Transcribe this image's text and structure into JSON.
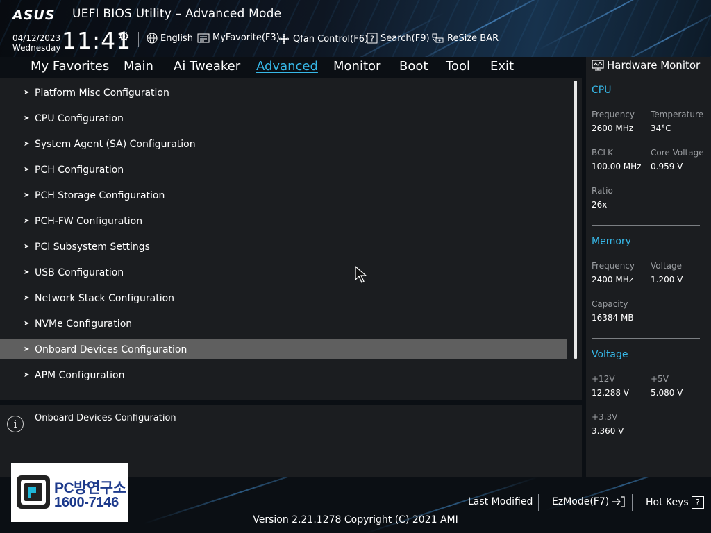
{
  "header": {
    "brand": "ASUS",
    "title": "UEFI BIOS Utility – Advanced Mode",
    "date": "04/12/2023",
    "weekday": "Wednesday",
    "time": "11:41",
    "settings_icon": "gear-icon",
    "toolbar": [
      {
        "label": "English",
        "icon": "globe-icon"
      },
      {
        "label": "MyFavorite(F3)",
        "icon": "favorite-icon"
      },
      {
        "label": "Qfan Control(F6)",
        "icon": "fan-icon"
      },
      {
        "label": "Search(F9)",
        "icon": "search-help-icon"
      },
      {
        "label": "ReSize BAR",
        "icon": "resize-bar-icon"
      }
    ]
  },
  "menu": {
    "items": [
      "My Favorites",
      "Main",
      "Ai Tweaker",
      "Advanced",
      "Monitor",
      "Boot",
      "Tool",
      "Exit"
    ],
    "active": "Advanced"
  },
  "advanced": {
    "items": [
      "Platform Misc Configuration",
      "CPU Configuration",
      "System Agent (SA) Configuration",
      "PCH Configuration",
      "PCH Storage Configuration",
      "PCH-FW Configuration",
      "PCI Subsystem Settings",
      "USB Configuration",
      "Network Stack Configuration",
      "NVMe Configuration",
      "Onboard Devices Configuration",
      "APM Configuration"
    ],
    "selected": "Onboard Devices Configuration"
  },
  "info": {
    "text": "Onboard Devices Configuration"
  },
  "hardware_monitor": {
    "title": "Hardware Monitor",
    "cpu": {
      "heading": "CPU",
      "frequency_label": "Frequency",
      "frequency": "2600 MHz",
      "temperature_label": "Temperature",
      "temperature": "34°C",
      "bclk_label": "BCLK",
      "bclk": "100.00 MHz",
      "core_voltage_label": "Core Voltage",
      "core_voltage": "0.959 V",
      "ratio_label": "Ratio",
      "ratio": "26x"
    },
    "memory": {
      "heading": "Memory",
      "frequency_label": "Frequency",
      "frequency": "2400 MHz",
      "voltage_label": "Voltage",
      "voltage": "1.200 V",
      "capacity_label": "Capacity",
      "capacity": "16384 MB"
    },
    "voltage": {
      "heading": "Voltage",
      "v12_label": "+12V",
      "v12": "12.288 V",
      "v5_label": "+5V",
      "v5": "5.080 V",
      "v33_label": "+3.3V",
      "v33": "3.360 V"
    }
  },
  "footer": {
    "last_modified": "Last Modified",
    "ezmode": "EzMode(F7)",
    "hot_keys": "Hot Keys",
    "hot_keys_icon": "?",
    "version": "Version 2.21.1278 Copyright (C) 2021 AMI"
  },
  "watermark": {
    "line1": "PC방연구소",
    "line2": "1600-7146"
  },
  "colors": {
    "accent": "#37b8e8",
    "panel": "#1b1d20",
    "selected_row": "#5f5f5f",
    "background": "#0b0f14"
  }
}
